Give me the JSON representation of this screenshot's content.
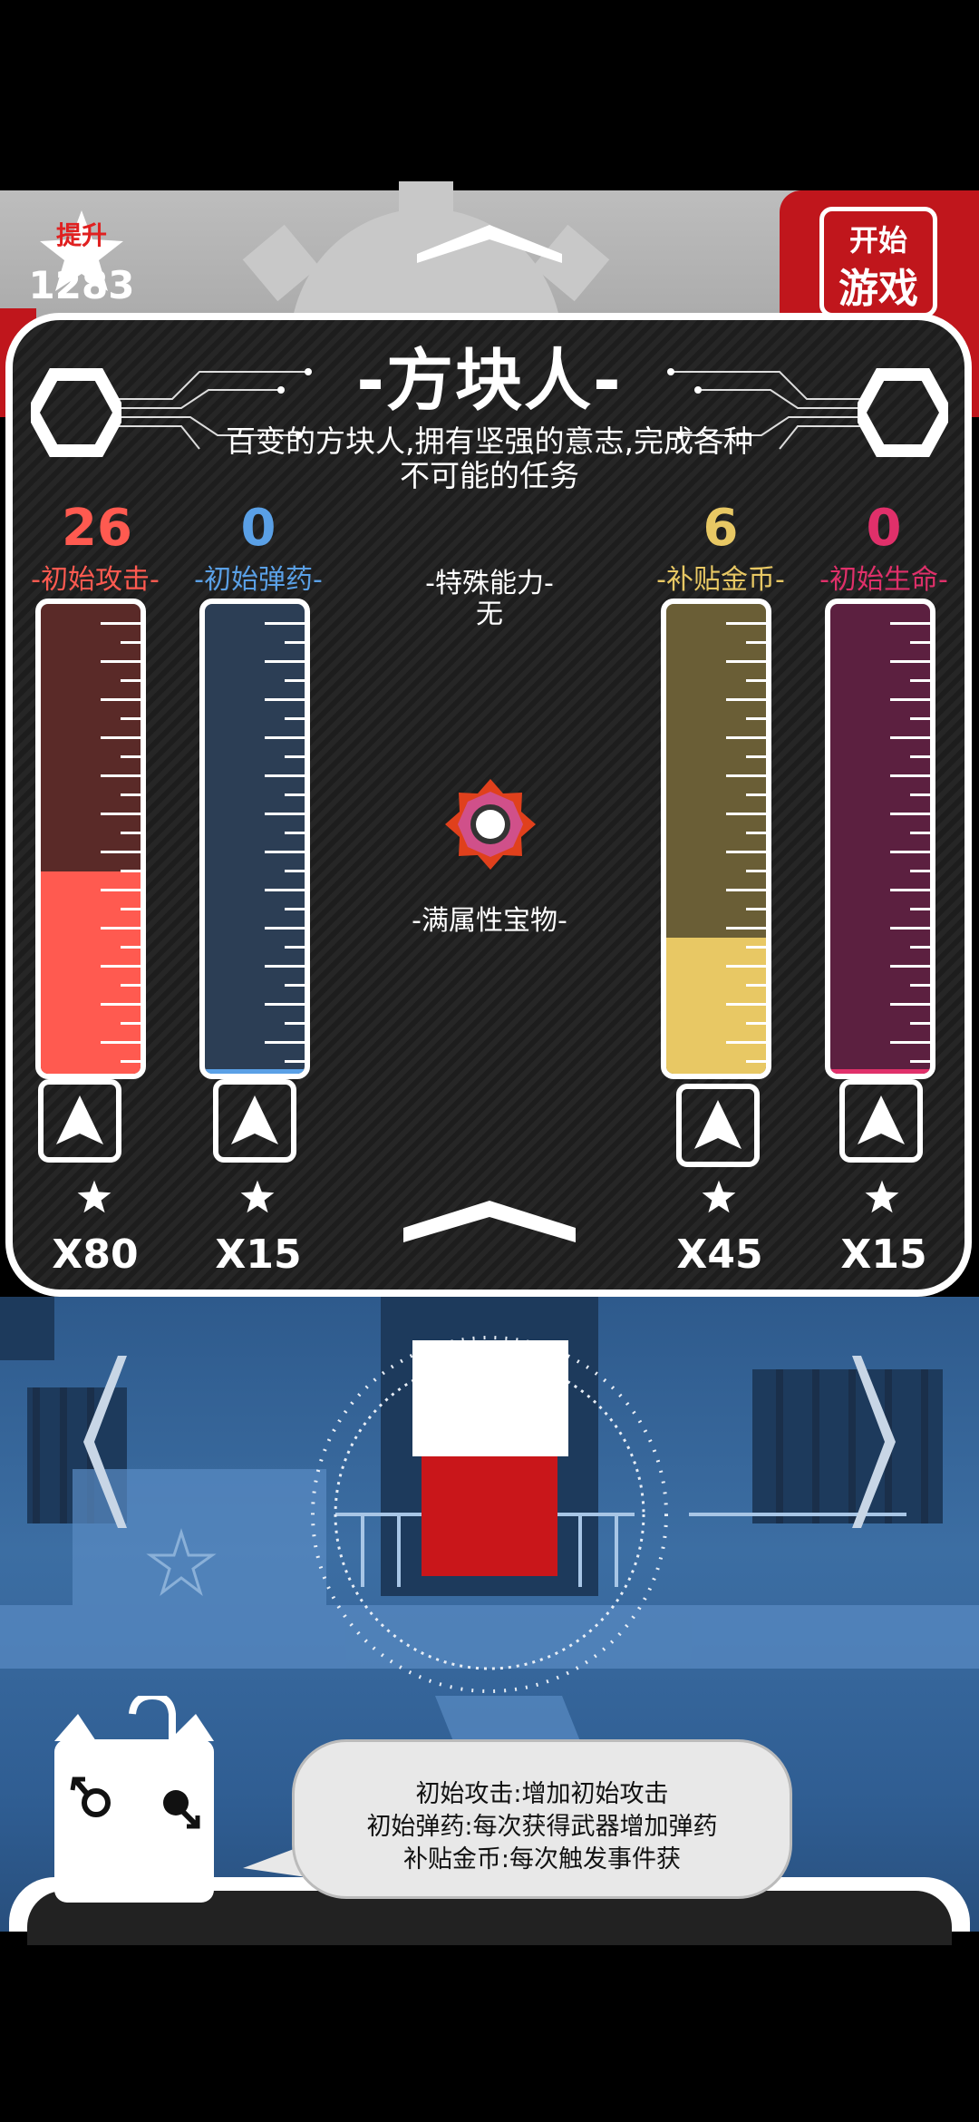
{
  "header": {
    "upgrade_badge_label": "提升",
    "score": "1283",
    "start_button_line1": "开始",
    "start_button_line2": "游戏"
  },
  "character": {
    "title": "-方块人-",
    "description": "百变的方块人,拥有坚强的意志,完成各种不可能的任务"
  },
  "stats": [
    {
      "value": "26",
      "label": "-初始攻击-",
      "cost": "X80",
      "color": "#ff5a50",
      "fill_fraction": 0.43
    },
    {
      "value": "0",
      "label": "-初始弹药-",
      "cost": "X15",
      "color": "#5aa0e6",
      "fill_fraction": 0.0
    },
    {
      "value": "6",
      "label": "-补贴金币-",
      "cost": "X45",
      "color": "#e8c864",
      "fill_fraction": 0.29
    },
    {
      "value": "0",
      "label": "-初始生命-",
      "cost": "X15",
      "color": "#e0306a",
      "fill_fraction": 0.0
    }
  ],
  "special": {
    "title": "-特殊能力-",
    "value": "无",
    "treasure_label": "-满属性宝物-"
  },
  "tip": {
    "lines": [
      "初始攻击:增加初始攻击",
      "初始弹药:每次获得武器增加弹药",
      "补贴金币:每次触发事件获"
    ]
  },
  "icons": [
    "star-icon",
    "gear-icon",
    "chevron-up-icon",
    "hexagon-icon",
    "arrow-up-icon",
    "sun-gem-icon",
    "chevron-left-icon",
    "chevron-right-icon",
    "male-symbol-icon"
  ]
}
